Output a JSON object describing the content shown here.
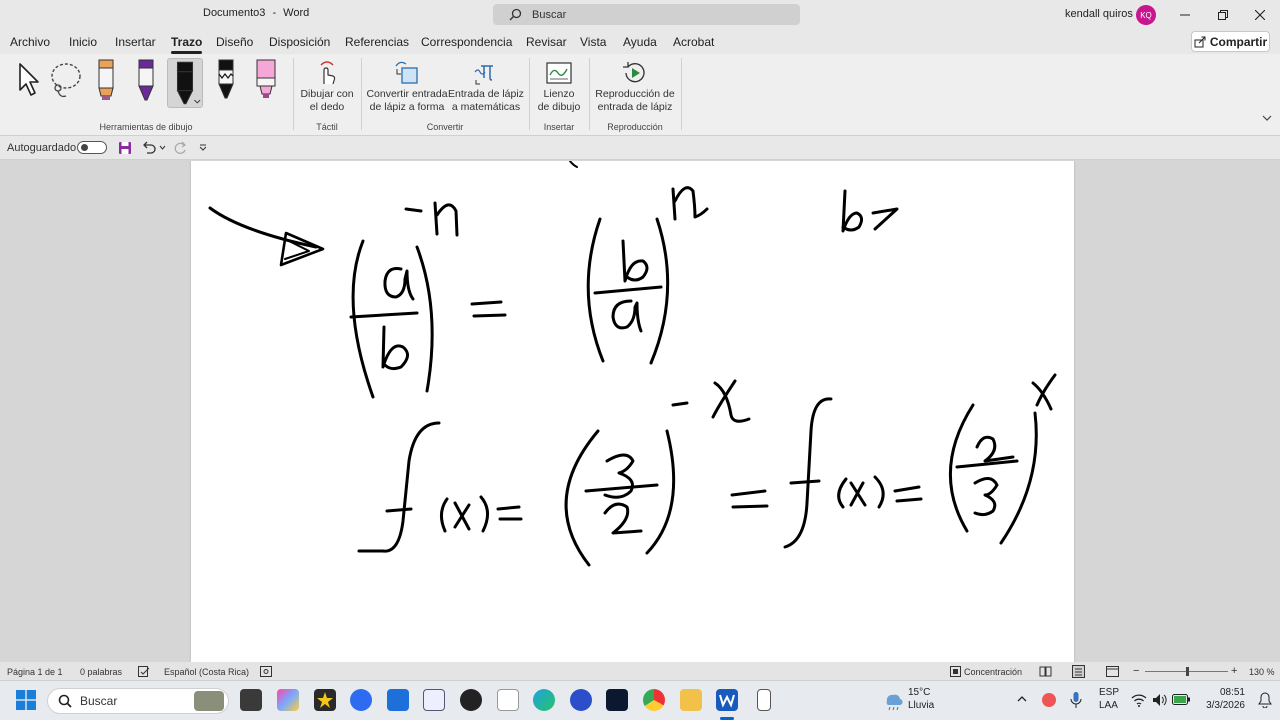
{
  "window": {
    "doc_name": "Documento3",
    "separator": "-",
    "app_name": "Word",
    "search_placeholder": "Buscar",
    "user_name": "kendall quiros",
    "user_initials": "KQ"
  },
  "menu": {
    "tabs": [
      "Archivo",
      "Inicio",
      "Insertar",
      "Trazo",
      "Diseño",
      "Disposición",
      "Referencias",
      "Correspondencia",
      "Revisar",
      "Vista",
      "Ayuda",
      "Acrobat"
    ],
    "active_tab": "Trazo",
    "share_label": "Compartir"
  },
  "ribbon": {
    "groups": {
      "drawing_tools": "Herramientas de dibujo",
      "touch": "Táctil",
      "convert": "Convertir",
      "insert": "Insertar",
      "replay": "Reproducción"
    },
    "buttons": {
      "finger_draw_1": "Dibujar con",
      "finger_draw_2": "el dedo",
      "ink_to_shape_1": "Convertir entrada",
      "ink_to_shape_2": "de lápiz a forma",
      "ink_to_math_1": "Entrada de lápiz",
      "ink_to_math_2": "a matemáticas",
      "canvas_1": "Lienzo",
      "canvas_2": "de dibujo",
      "ink_replay_1": "Reproducción de",
      "ink_replay_2": "entrada de lápiz"
    },
    "pen_colors": {
      "highlighter_orange": "#e8a25a",
      "pen_purple": "#6a2a9a",
      "pen_black": "#111111",
      "highlighter_pink": "#f5a8d8"
    }
  },
  "qat": {
    "autosave_label": "Autoguardado"
  },
  "status": {
    "page": "Página 1 de 1",
    "words": "0 palabras",
    "language": "Español (Costa Rica)",
    "focus": "Concentración",
    "zoom": "130 %"
  },
  "taskbar": {
    "search_label": "Buscar",
    "weather_temp": "15°C",
    "weather_desc": "Lluvia",
    "lang_1": "ESP",
    "lang_2": "LAA",
    "time": "08:51",
    "date": "3/3/2026"
  }
}
